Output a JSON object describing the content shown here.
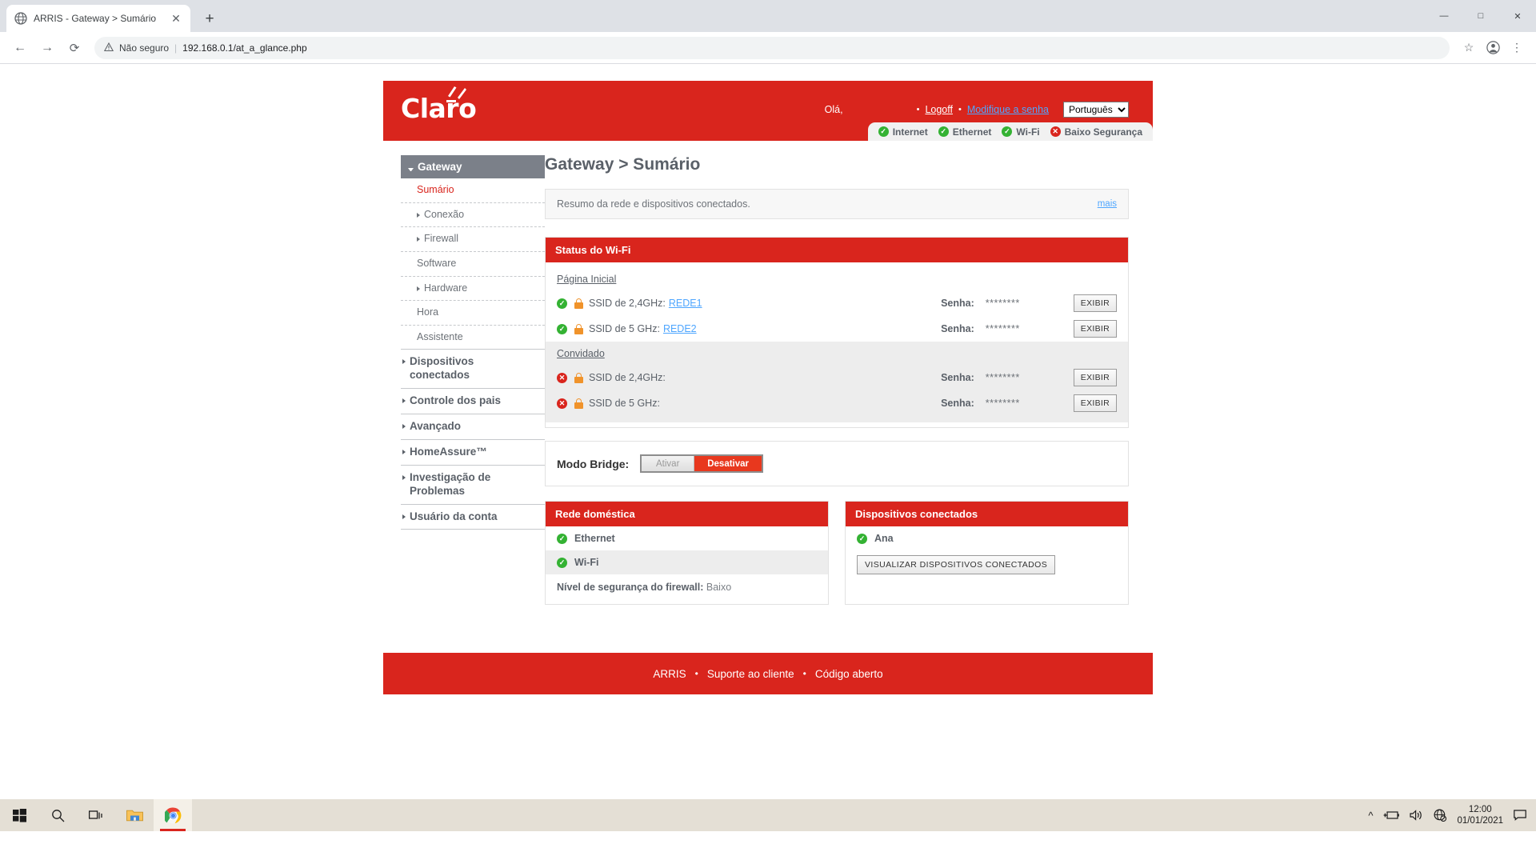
{
  "browser": {
    "tab_title": "ARRIS - Gateway > Sumário",
    "tab_close": "✕",
    "new_tab": "+",
    "back": "←",
    "forward": "→",
    "reload": "⟳",
    "security_icon": "warning-triangle",
    "security_text": "Não seguro",
    "separator": "|",
    "url": "192.168.0.1/at_a_glance.php",
    "star": "☆",
    "profile": "●",
    "menu": "⋮",
    "minimize": "—",
    "maximize": "□",
    "close": "✕"
  },
  "header": {
    "logo_text": "Claro",
    "greeting": "Olá,",
    "dot": "•",
    "logoff": "Logoff",
    "change_password": "Modifique a senha",
    "language": "Português",
    "language_options": [
      "Português"
    ]
  },
  "status_pill": [
    {
      "label": "Internet",
      "state": "ok"
    },
    {
      "label": "Ethernet",
      "state": "ok"
    },
    {
      "label": "Wi-Fi",
      "state": "ok"
    },
    {
      "label": "Baixo Segurança",
      "state": "error"
    }
  ],
  "sidebar": {
    "gateway": "Gateway",
    "items": [
      {
        "label": "Sumário",
        "type": "sub",
        "active": true,
        "caret": false
      },
      {
        "label": "Conexão",
        "type": "sub",
        "active": false,
        "caret": true
      },
      {
        "label": "Firewall",
        "type": "sub",
        "active": false,
        "caret": true
      },
      {
        "label": "Software",
        "type": "sub",
        "active": false,
        "caret": false
      },
      {
        "label": "Hardware",
        "type": "sub",
        "active": false,
        "caret": true
      },
      {
        "label": "Hora",
        "type": "sub",
        "active": false,
        "caret": false
      },
      {
        "label": "Assistente",
        "type": "sub",
        "active": false,
        "caret": false
      }
    ],
    "top_items": [
      {
        "label": "Dispositivos conectados"
      },
      {
        "label": "Controle dos pais"
      },
      {
        "label": "Avançado"
      },
      {
        "label": "HomeAssure™"
      },
      {
        "label": "Investigação de Problemas"
      },
      {
        "label": "Usuário da conta"
      }
    ]
  },
  "main": {
    "page_title": "Gateway > Sumário",
    "summary_text": "Resumo da rede e dispositivos conectados.",
    "summary_more": "mais",
    "wifi_panel": {
      "title": "Status do Wi-Fi",
      "home_group": "Página Inicial",
      "guest_group": "Convidado",
      "senha_label": "Senha:",
      "mask": "********",
      "exibir": "EXIBIR",
      "home_rows": [
        {
          "state": "ok",
          "label": "SSID de 2,4GHz:",
          "ssid": "REDE1"
        },
        {
          "state": "ok",
          "label": "SSID de 5 GHz:",
          "ssid": "REDE2"
        }
      ],
      "guest_rows": [
        {
          "state": "error",
          "label": "SSID de 2,4GHz:",
          "ssid": ""
        },
        {
          "state": "error",
          "label": "SSID de 5 GHz:",
          "ssid": ""
        }
      ]
    },
    "bridge": {
      "label": "Modo Bridge:",
      "enable": "Ativar",
      "disable": "Desativar",
      "selected": "Desativar"
    },
    "home_network": {
      "title": "Rede doméstica",
      "rows": [
        {
          "label": "Ethernet",
          "state": "ok"
        },
        {
          "label": "Wi-Fi",
          "state": "ok"
        }
      ],
      "firewall_label": "Nível de segurança do firewall:",
      "firewall_value": "Baixo"
    },
    "connected_devices": {
      "title": "Dispositivos conectados",
      "rows": [
        {
          "label": "Ana",
          "state": "ok"
        }
      ],
      "button": "VISUALIZAR DISPOSITIVOS CONECTADOS"
    }
  },
  "footer": {
    "arris": "ARRIS",
    "dot": "•",
    "support": "Suporte ao cliente",
    "open_source": "Código aberto"
  },
  "taskbar": {
    "start": "start-icon",
    "search": "search-icon",
    "taskview": "task-view-icon",
    "explorer": "file-explorer-icon",
    "chrome": "chrome-icon",
    "chevron": "^",
    "battery": "battery-icon",
    "volume": "volume-icon",
    "network": "network-offline-icon",
    "time": "12:00",
    "date": "01/01/2021",
    "notifications": "notification-icon"
  },
  "colors": {
    "brand_red": "#d9251d",
    "ok_green": "#34b233",
    "link_blue": "#4ea6ff",
    "lock_orange": "#f0932b"
  }
}
